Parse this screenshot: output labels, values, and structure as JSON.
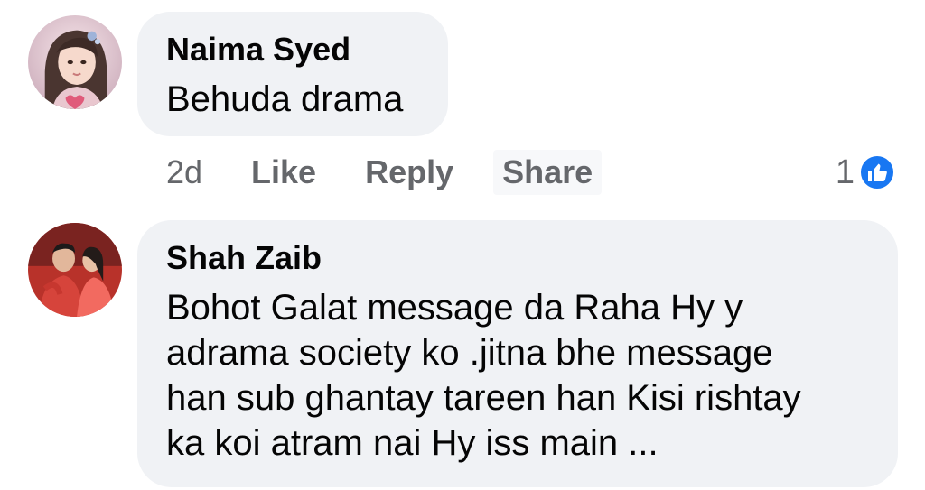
{
  "comments": [
    {
      "author": "Naima Syed",
      "text_lines": [
        "Behuda drama"
      ],
      "time": "2d",
      "actions": {
        "like": "Like",
        "reply": "Reply",
        "share": "Share"
      },
      "reaction_count": "1",
      "reaction_icon": "like-icon"
    },
    {
      "author": "Shah Zaib",
      "text_lines": [
        "Bohot Galat message da Raha Hy y",
        "adrama society ko .jitna bhe message",
        "han sub ghantay tareen han Kisi rishtay",
        "ka koi atram nai Hy iss main ..."
      ]
    }
  ],
  "colors": {
    "bubble": "#f0f2f5",
    "text": "#050505",
    "secondary": "#65676b",
    "like_blue": "#1877f2"
  }
}
